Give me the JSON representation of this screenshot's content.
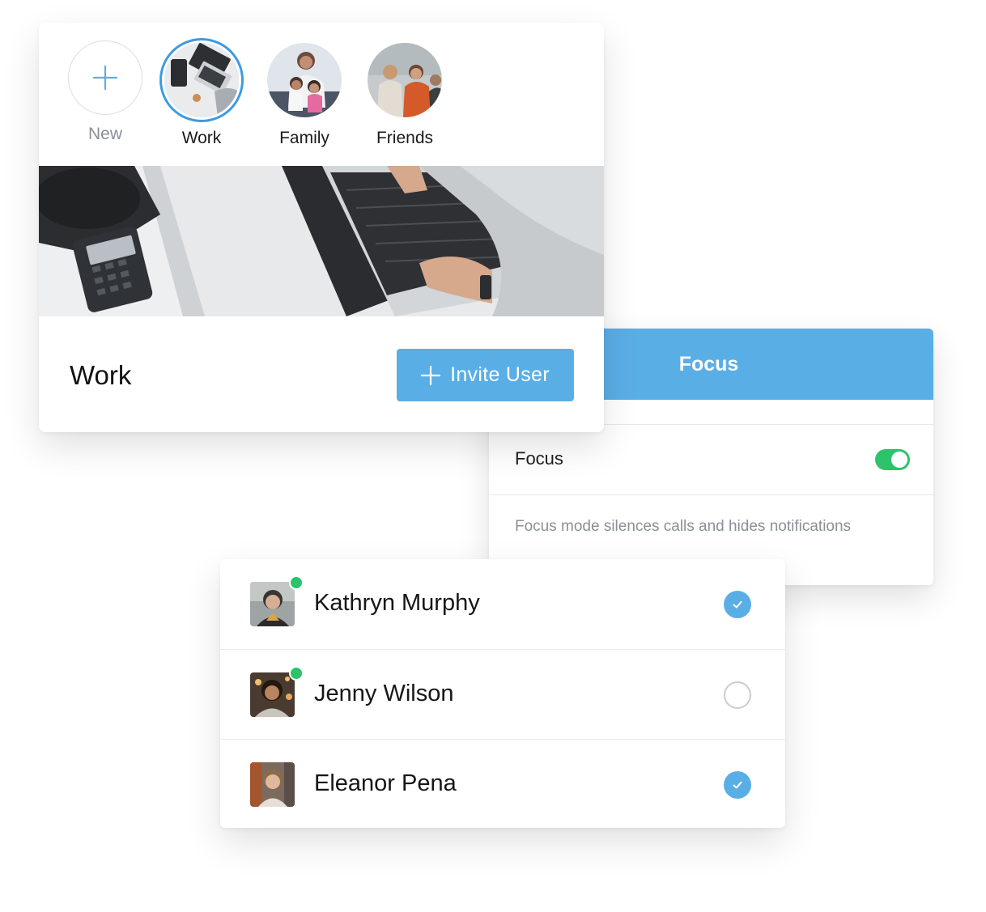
{
  "circles": [
    {
      "label": "New",
      "kind": "add",
      "icon": "plus-icon"
    },
    {
      "label": "Work",
      "kind": "photo",
      "selected": true
    },
    {
      "label": "Family",
      "kind": "photo",
      "selected": false
    },
    {
      "label": "Friends",
      "kind": "photo",
      "selected": false
    }
  ],
  "card": {
    "group_name": "Work",
    "invite_label": "Invite User",
    "invite_icon": "plus-icon"
  },
  "focus": {
    "header": "Focus",
    "row_label": "Focus",
    "enabled": true,
    "description": "Focus mode silences calls and hides notifications"
  },
  "users": [
    {
      "name": "Kathryn Murphy",
      "online": true,
      "checked": true
    },
    {
      "name": "Jenny Wilson",
      "online": true,
      "checked": false
    },
    {
      "name": "Eleanor Pena",
      "online": false,
      "checked": true
    }
  ],
  "colors": {
    "accent": "#5aaee6",
    "online": "#2cc36b",
    "toggle_on": "#2cc36b",
    "muted_text": "#8b9096"
  }
}
